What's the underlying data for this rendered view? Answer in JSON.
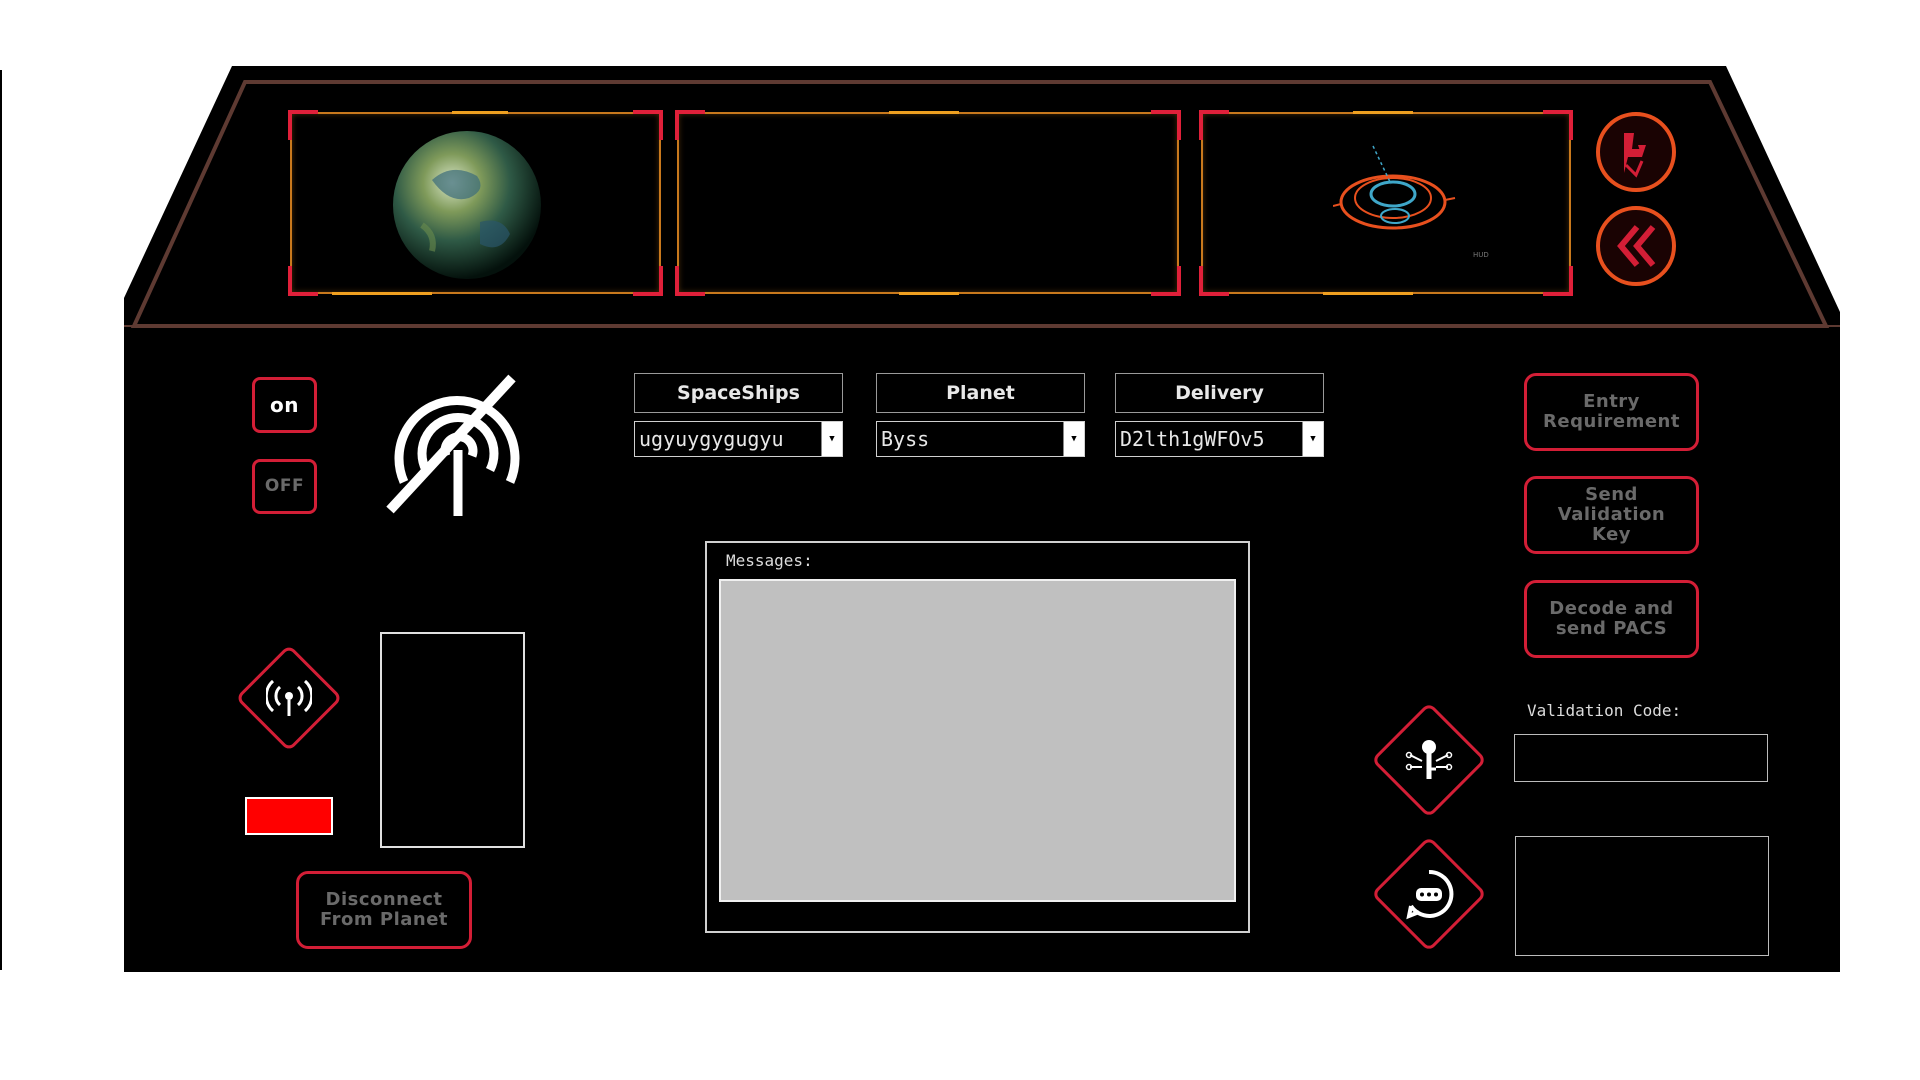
{
  "controls": {
    "on_label": "on",
    "off_label": "OFF",
    "disconnect_label": "Disconnect From Planet"
  },
  "selectors": {
    "spaceships": {
      "label": "SpaceShips",
      "value": "ugyuygygugyu"
    },
    "planet": {
      "label": "Planet",
      "value": "Byss"
    },
    "delivery": {
      "label": "Delivery",
      "value": "D2lth1gWFOv5"
    }
  },
  "messages": {
    "label": "Messages:",
    "content": ""
  },
  "actions": {
    "entry_requirement": "Entry Requirement",
    "send_validation_key": "Send Validation Key",
    "decode_send_pacs": "Decode and send PACS"
  },
  "validation": {
    "label": "Validation Code:",
    "value": ""
  },
  "screens": {
    "hud_caption": "HUD"
  },
  "icons": {
    "pilot": "pilot-seat-icon",
    "back": "double-chevron-left-icon",
    "no_signal": "no-signal-icon",
    "broadcast": "broadcast-icon",
    "key": "circuit-key-icon",
    "message": "message-bubble-icon"
  },
  "colors": {
    "accent_red": "#d31e36",
    "accent_orange": "#e8501e",
    "status_red": "#ff0000",
    "panel_bg": "#000000",
    "message_bg": "#c0c0c0"
  }
}
